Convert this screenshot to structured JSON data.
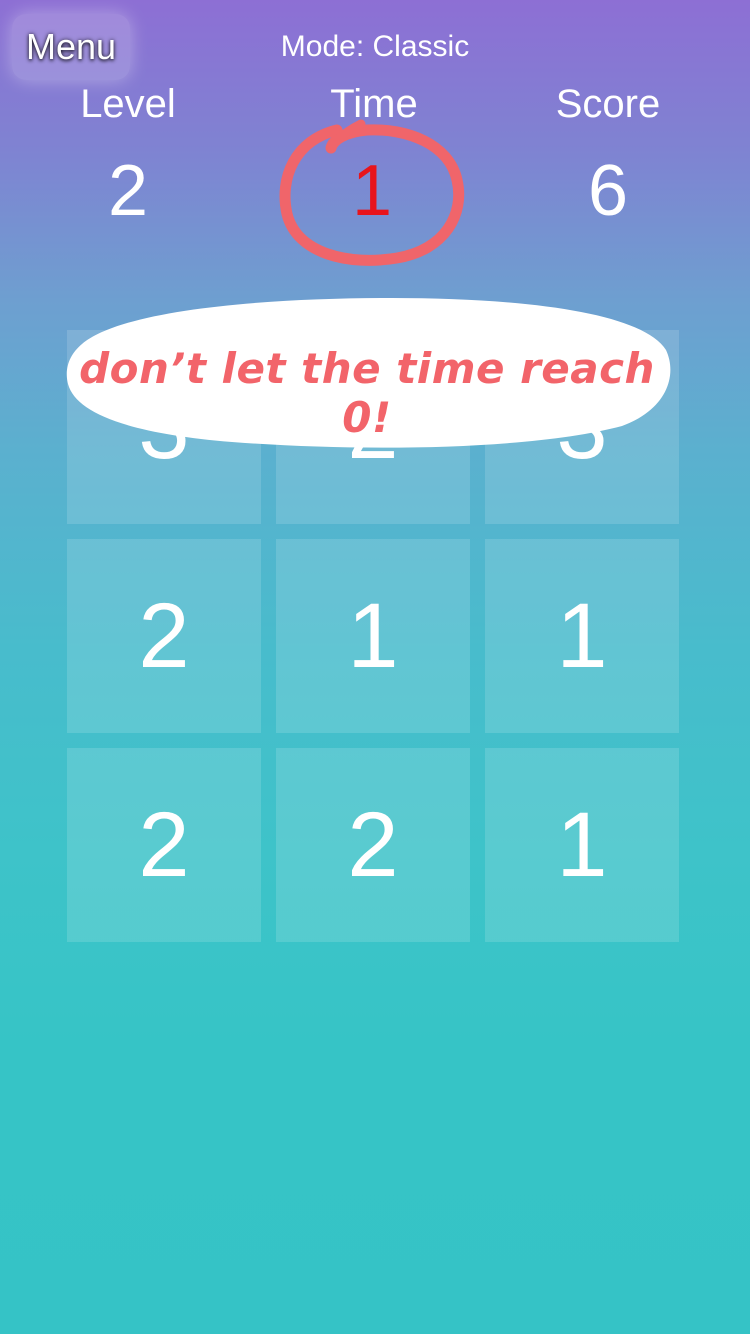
{
  "header": {
    "menu_label": "Menu",
    "mode_label": "Mode: Classic"
  },
  "stats": {
    "level_title": "Level",
    "level_value": "2",
    "time_title": "Time",
    "time_value": "1",
    "score_title": "Score",
    "score_value": "6"
  },
  "board": {
    "tiles": [
      [
        "3",
        "2",
        "3"
      ],
      [
        "2",
        "1",
        "1"
      ],
      [
        "2",
        "2",
        "1"
      ]
    ]
  },
  "annotation": {
    "text": "don’t let the time reach 0!",
    "color": "#f2646a"
  },
  "colors": {
    "timer_value": "#e8141c",
    "background_top": "#8d6fd4",
    "background_bottom": "#35c3c6"
  }
}
